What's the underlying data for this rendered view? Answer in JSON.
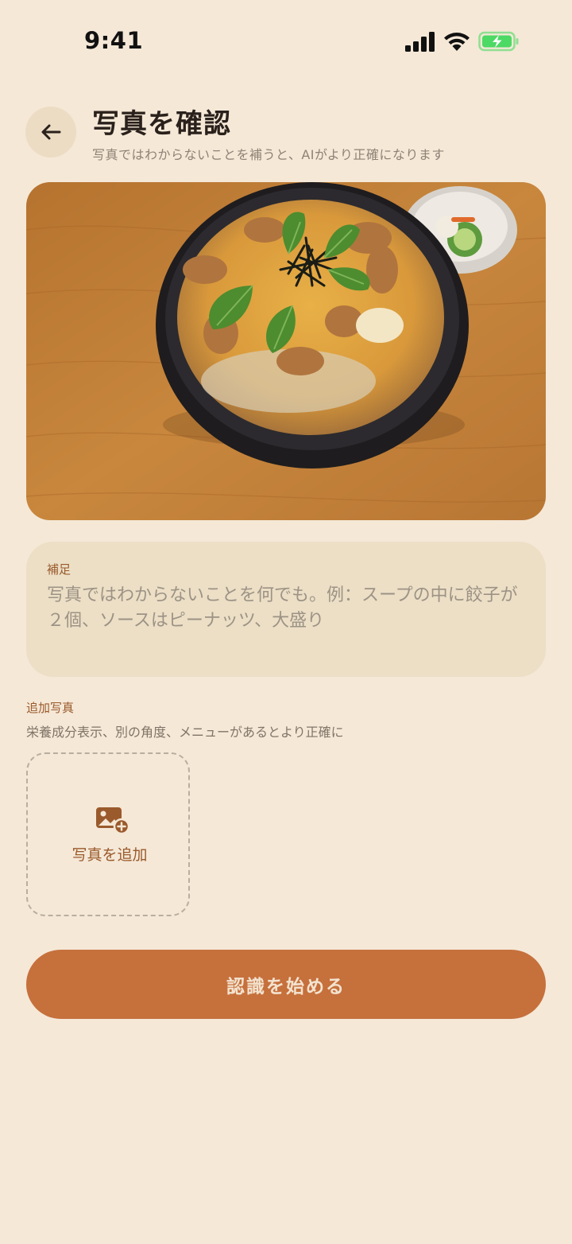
{
  "status_bar": {
    "time": "9:41"
  },
  "header": {
    "title": "写真を確認",
    "subtitle": "写真ではわからないことを補うと、AIがより正確になります"
  },
  "note": {
    "label": "補足",
    "placeholder": "写真ではわからないことを何でも。例：スープの中に餃子が２個、ソースはピーナッツ、大盛り"
  },
  "extra_photos": {
    "title": "追加写真",
    "subtitle": "栄養成分表示、別の角度、メニューがあるとより正確に",
    "add_label": "写真を追加"
  },
  "start_button": {
    "label": "認識を始める"
  },
  "icons": {
    "back": "arrow-left-icon",
    "add_photo": "image-plus-icon",
    "signal": "cellular-signal-icon",
    "wifi": "wifi-icon",
    "battery": "battery-charging-icon"
  },
  "colors": {
    "background": "#f5e8d7",
    "accent": "#c6703c",
    "label_brown": "#9a5a2c",
    "battery_green": "#4cd964"
  }
}
